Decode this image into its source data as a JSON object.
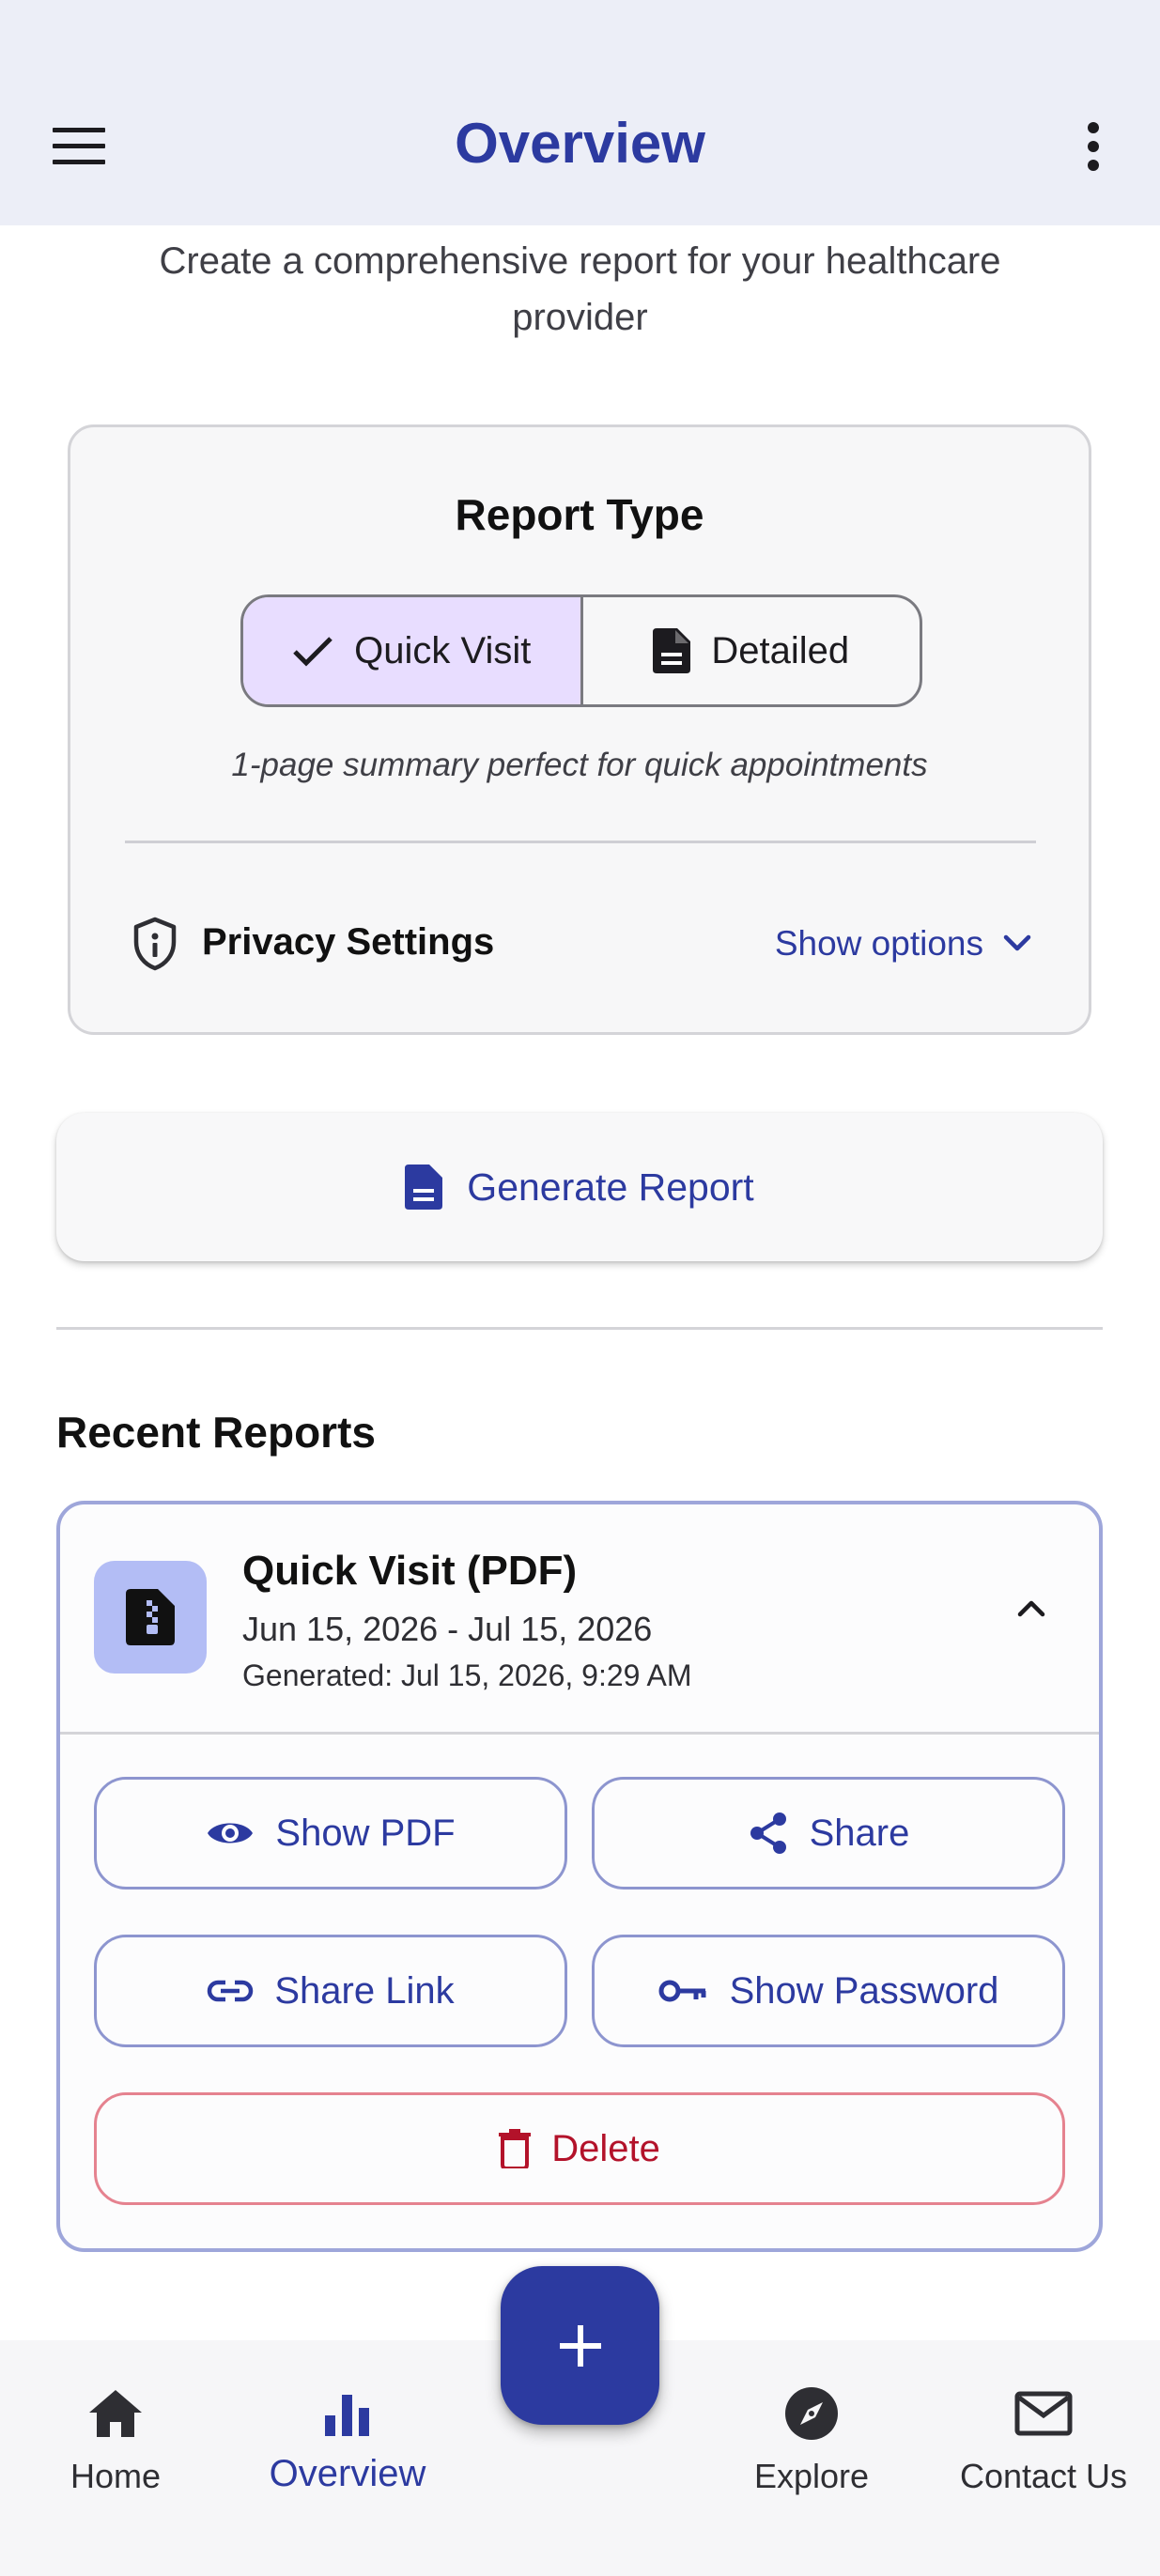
{
  "app_bar": {
    "title": "Overview"
  },
  "intro": {
    "subtitle": "Create a comprehensive report for your healthcare provider"
  },
  "report_type": {
    "title": "Report Type",
    "options": [
      {
        "label": "Quick Visit",
        "selected": true
      },
      {
        "label": "Detailed",
        "selected": false
      }
    ],
    "description": "1-page summary perfect for quick appointments"
  },
  "privacy": {
    "label": "Privacy Settings",
    "toggle_label": "Show options"
  },
  "generate": {
    "label": "Generate Report"
  },
  "recent": {
    "section_title": "Recent Reports",
    "reports": [
      {
        "title": "Quick Visit (PDF)",
        "date_range": "Jun 15, 2026 - Jul 15, 2026",
        "generated": "Generated: Jul 15, 2026, 9:29 AM",
        "actions": {
          "show_pdf": "Show PDF",
          "share": "Share",
          "share_link": "Share Link",
          "show_password": "Show Password",
          "delete": "Delete"
        }
      }
    ]
  },
  "bottom_nav": {
    "items": [
      {
        "label": "Home",
        "icon": "home-icon",
        "active": false
      },
      {
        "label": "Overview",
        "icon": "bar-chart-icon",
        "active": true
      },
      {
        "label": "Explore",
        "icon": "compass-icon",
        "active": false
      },
      {
        "label": "Contact Us",
        "icon": "mail-icon",
        "active": false
      }
    ]
  },
  "fab": {
    "icon": "plus-icon"
  },
  "colors": {
    "primary": "#2c3aa0",
    "selected_segment": "#e8ddff",
    "file_tile": "#b3bdf5",
    "danger": "#b3122a",
    "app_bar_bg": "#eceef7"
  }
}
